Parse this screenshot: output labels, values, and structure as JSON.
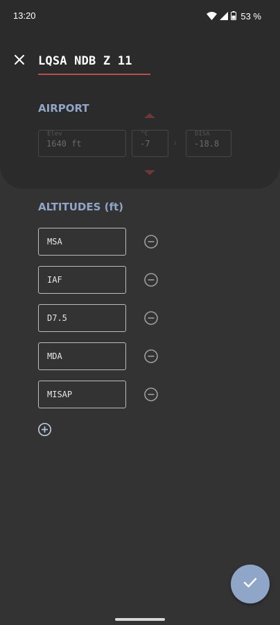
{
  "status_bar": {
    "time": "13:20",
    "battery": "53 %",
    "icons": [
      "wifi-icon",
      "signal-icon",
      "battery-icon"
    ]
  },
  "header": {
    "close_icon": "close-icon",
    "title": "LQSA NDB Z 11"
  },
  "airport": {
    "section_title": "AIRPORT",
    "elevation": {
      "label": "Elev",
      "value": "1640 ft"
    },
    "temperature": {
      "label": "°C",
      "value": "-7"
    },
    "disa": {
      "label": "DISA",
      "value": "-18.8"
    }
  },
  "altitudes": {
    "section_title": "ALTITUDES (ft)",
    "items": [
      {
        "value": "MSA"
      },
      {
        "value": "IAF"
      },
      {
        "value": "D7.5"
      },
      {
        "value": "MDA"
      },
      {
        "value": "MISAP"
      }
    ],
    "remove_icon": "minus-circle-icon",
    "add_icon": "plus-circle-icon"
  },
  "fab": {
    "icon": "check-icon"
  },
  "colors": {
    "accent": "#8fa6c9",
    "underline": "#b85050",
    "background": "#333333",
    "panel": "#2b2b2b"
  }
}
